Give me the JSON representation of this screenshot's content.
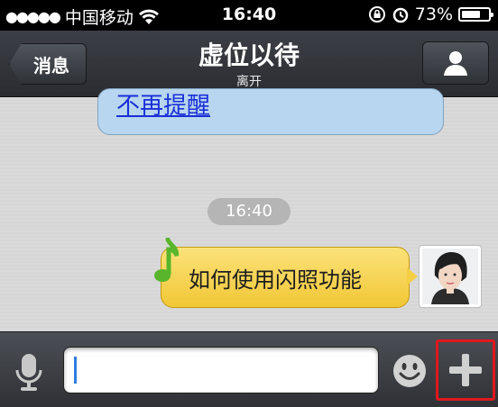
{
  "status_bar": {
    "signal_dots": "●●●●●",
    "carrier": "中国移动",
    "wifi_icon": "wifi-icon",
    "time": "16:40",
    "battery_percent": "73%",
    "battery_level": 0.73
  },
  "nav": {
    "back_label": "消息",
    "title": "虚位以待",
    "subtitle": "离开"
  },
  "chat": {
    "previous_link": "不再提醒",
    "timestamp": "16:40",
    "message": "如何使用闪照功能"
  },
  "input_bar": {
    "text_value": ""
  },
  "colors": {
    "bubble_yellow": "#f4cf45",
    "link_blue": "#1a2fd8",
    "highlight_red": "#e0171c"
  }
}
